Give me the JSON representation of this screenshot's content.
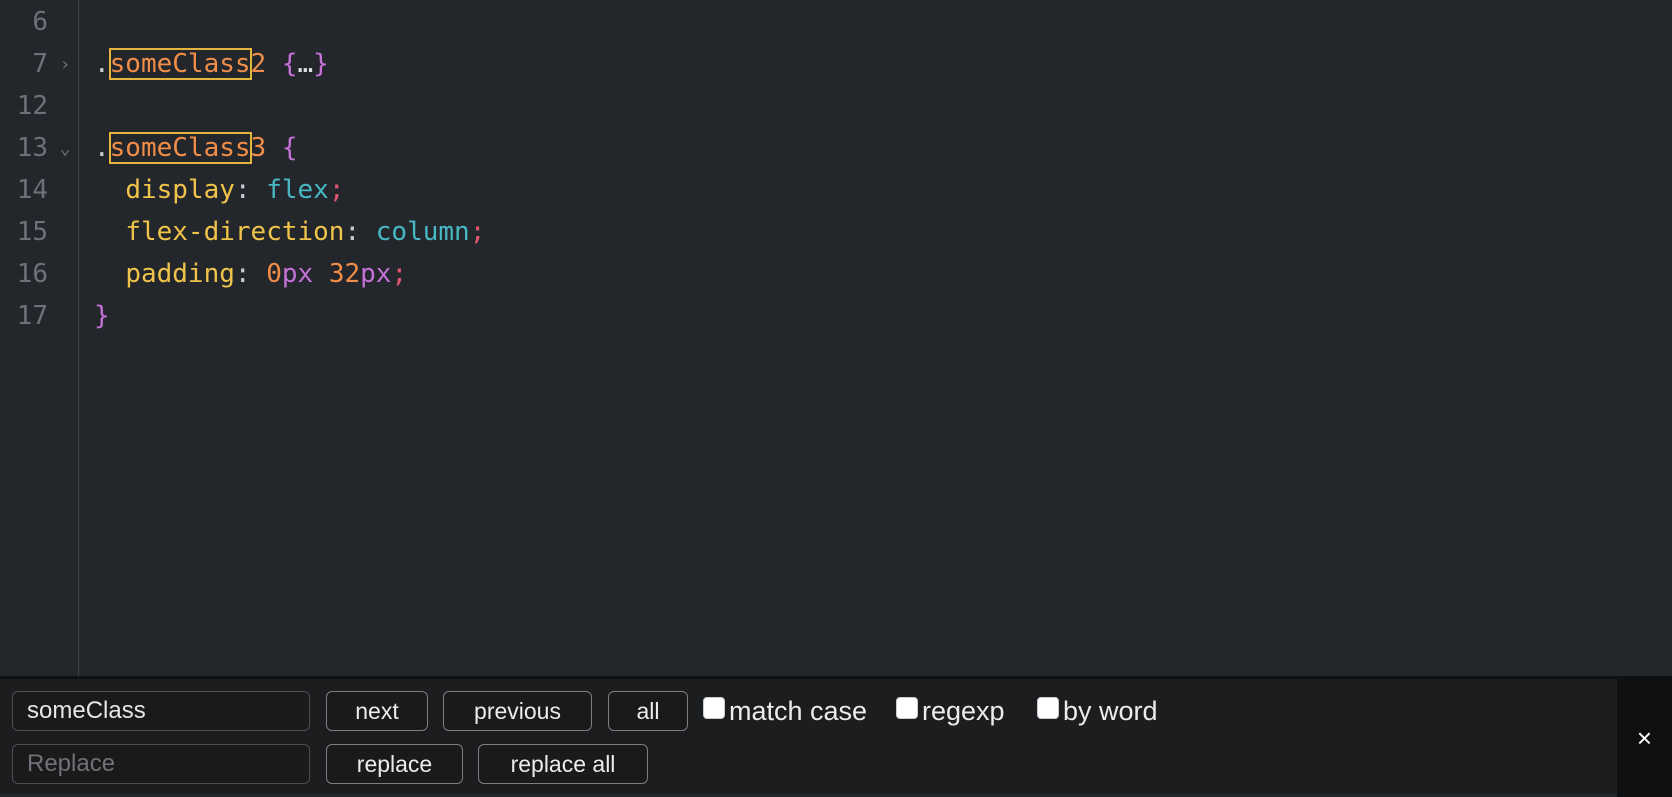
{
  "editor": {
    "lines": {
      "l6": {
        "num": "6"
      },
      "l7": {
        "num": "7",
        "dot": ".",
        "sel_match": "someClass",
        "sel_rest": "2",
        "open": "{",
        "ellipsis": "…",
        "close": "}"
      },
      "l12": {
        "num": "12"
      },
      "l13": {
        "num": "13",
        "dot": ".",
        "sel_match": "someClass",
        "sel_rest": "3",
        "open": "{"
      },
      "l14": {
        "num": "14",
        "prop": "display",
        "colon": ":",
        "value": "flex",
        "semi": ";"
      },
      "l15": {
        "num": "15",
        "prop": "flex-direction",
        "colon": ":",
        "value": "column",
        "semi": ";"
      },
      "l16": {
        "num": "16",
        "prop": "padding",
        "colon": ":",
        "num1": "0",
        "unit1": "px",
        "num2": "32",
        "unit2": "px",
        "semi": ";"
      },
      "l17": {
        "num": "17",
        "close": "}"
      }
    },
    "fold_collapsed": "›",
    "fold_expanded": "⌄"
  },
  "search": {
    "find_value": "someClass",
    "replace_placeholder": "Replace",
    "next_label": "next",
    "previous_label": "previous",
    "all_label": "all",
    "match_case_label": "match case",
    "regexp_label": "regexp",
    "by_word_label": "by word",
    "replace_label": "replace",
    "replace_all_label": "replace all",
    "close_symbol": "×"
  },
  "colors": {
    "background": "#23262a",
    "selector": "#f08d49",
    "match_highlight": "#e5b63d",
    "property": "#f0c34a",
    "keyword_value": "#48b8c4",
    "brace": "#c471d8",
    "semicolon": "#e0556f"
  }
}
